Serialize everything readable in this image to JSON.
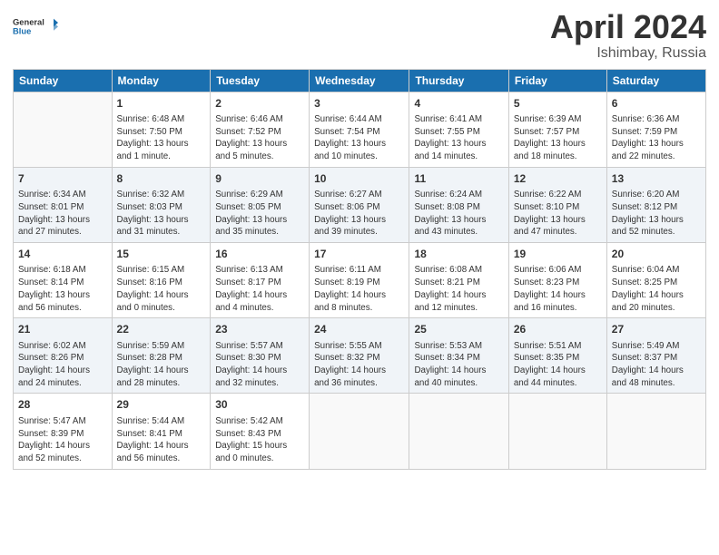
{
  "logo": {
    "line1": "General",
    "line2": "Blue"
  },
  "title": "April 2024",
  "subtitle": "Ishimbay, Russia",
  "header_days": [
    "Sunday",
    "Monday",
    "Tuesday",
    "Wednesday",
    "Thursday",
    "Friday",
    "Saturday"
  ],
  "weeks": [
    [
      {
        "num": "",
        "info": ""
      },
      {
        "num": "1",
        "info": "Sunrise: 6:48 AM\nSunset: 7:50 PM\nDaylight: 13 hours\nand 1 minute."
      },
      {
        "num": "2",
        "info": "Sunrise: 6:46 AM\nSunset: 7:52 PM\nDaylight: 13 hours\nand 5 minutes."
      },
      {
        "num": "3",
        "info": "Sunrise: 6:44 AM\nSunset: 7:54 PM\nDaylight: 13 hours\nand 10 minutes."
      },
      {
        "num": "4",
        "info": "Sunrise: 6:41 AM\nSunset: 7:55 PM\nDaylight: 13 hours\nand 14 minutes."
      },
      {
        "num": "5",
        "info": "Sunrise: 6:39 AM\nSunset: 7:57 PM\nDaylight: 13 hours\nand 18 minutes."
      },
      {
        "num": "6",
        "info": "Sunrise: 6:36 AM\nSunset: 7:59 PM\nDaylight: 13 hours\nand 22 minutes."
      }
    ],
    [
      {
        "num": "7",
        "info": "Sunrise: 6:34 AM\nSunset: 8:01 PM\nDaylight: 13 hours\nand 27 minutes."
      },
      {
        "num": "8",
        "info": "Sunrise: 6:32 AM\nSunset: 8:03 PM\nDaylight: 13 hours\nand 31 minutes."
      },
      {
        "num": "9",
        "info": "Sunrise: 6:29 AM\nSunset: 8:05 PM\nDaylight: 13 hours\nand 35 minutes."
      },
      {
        "num": "10",
        "info": "Sunrise: 6:27 AM\nSunset: 8:06 PM\nDaylight: 13 hours\nand 39 minutes."
      },
      {
        "num": "11",
        "info": "Sunrise: 6:24 AM\nSunset: 8:08 PM\nDaylight: 13 hours\nand 43 minutes."
      },
      {
        "num": "12",
        "info": "Sunrise: 6:22 AM\nSunset: 8:10 PM\nDaylight: 13 hours\nand 47 minutes."
      },
      {
        "num": "13",
        "info": "Sunrise: 6:20 AM\nSunset: 8:12 PM\nDaylight: 13 hours\nand 52 minutes."
      }
    ],
    [
      {
        "num": "14",
        "info": "Sunrise: 6:18 AM\nSunset: 8:14 PM\nDaylight: 13 hours\nand 56 minutes."
      },
      {
        "num": "15",
        "info": "Sunrise: 6:15 AM\nSunset: 8:16 PM\nDaylight: 14 hours\nand 0 minutes."
      },
      {
        "num": "16",
        "info": "Sunrise: 6:13 AM\nSunset: 8:17 PM\nDaylight: 14 hours\nand 4 minutes."
      },
      {
        "num": "17",
        "info": "Sunrise: 6:11 AM\nSunset: 8:19 PM\nDaylight: 14 hours\nand 8 minutes."
      },
      {
        "num": "18",
        "info": "Sunrise: 6:08 AM\nSunset: 8:21 PM\nDaylight: 14 hours\nand 12 minutes."
      },
      {
        "num": "19",
        "info": "Sunrise: 6:06 AM\nSunset: 8:23 PM\nDaylight: 14 hours\nand 16 minutes."
      },
      {
        "num": "20",
        "info": "Sunrise: 6:04 AM\nSunset: 8:25 PM\nDaylight: 14 hours\nand 20 minutes."
      }
    ],
    [
      {
        "num": "21",
        "info": "Sunrise: 6:02 AM\nSunset: 8:26 PM\nDaylight: 14 hours\nand 24 minutes."
      },
      {
        "num": "22",
        "info": "Sunrise: 5:59 AM\nSunset: 8:28 PM\nDaylight: 14 hours\nand 28 minutes."
      },
      {
        "num": "23",
        "info": "Sunrise: 5:57 AM\nSunset: 8:30 PM\nDaylight: 14 hours\nand 32 minutes."
      },
      {
        "num": "24",
        "info": "Sunrise: 5:55 AM\nSunset: 8:32 PM\nDaylight: 14 hours\nand 36 minutes."
      },
      {
        "num": "25",
        "info": "Sunrise: 5:53 AM\nSunset: 8:34 PM\nDaylight: 14 hours\nand 40 minutes."
      },
      {
        "num": "26",
        "info": "Sunrise: 5:51 AM\nSunset: 8:35 PM\nDaylight: 14 hours\nand 44 minutes."
      },
      {
        "num": "27",
        "info": "Sunrise: 5:49 AM\nSunset: 8:37 PM\nDaylight: 14 hours\nand 48 minutes."
      }
    ],
    [
      {
        "num": "28",
        "info": "Sunrise: 5:47 AM\nSunset: 8:39 PM\nDaylight: 14 hours\nand 52 minutes."
      },
      {
        "num": "29",
        "info": "Sunrise: 5:44 AM\nSunset: 8:41 PM\nDaylight: 14 hours\nand 56 minutes."
      },
      {
        "num": "30",
        "info": "Sunrise: 5:42 AM\nSunset: 8:43 PM\nDaylight: 15 hours\nand 0 minutes."
      },
      {
        "num": "",
        "info": ""
      },
      {
        "num": "",
        "info": ""
      },
      {
        "num": "",
        "info": ""
      },
      {
        "num": "",
        "info": ""
      }
    ]
  ]
}
